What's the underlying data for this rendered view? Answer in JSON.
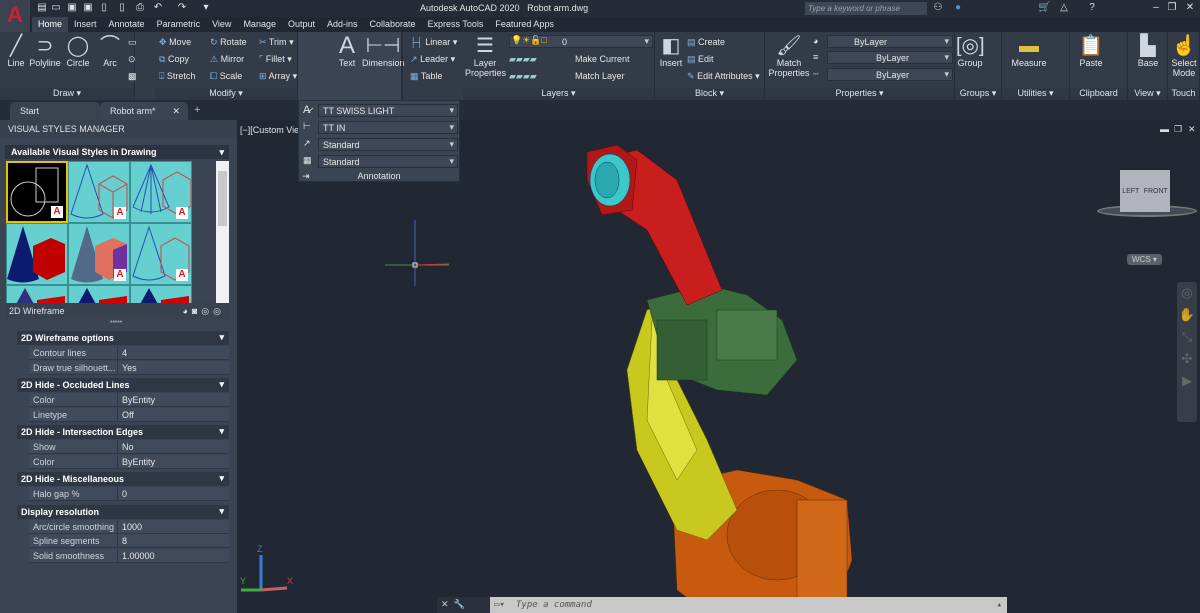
{
  "app": {
    "title": "Autodesk AutoCAD 2020",
    "file": "Robot arm.dwg",
    "logo": "A"
  },
  "search": {
    "placeholder": "Type a keyword or phrase"
  },
  "menu_tabs": [
    "Home",
    "Insert",
    "Annotate",
    "Parametric",
    "View",
    "Manage",
    "Output",
    "Add-ins",
    "Collaborate",
    "Express Tools",
    "Featured Apps"
  ],
  "active_tab": "Home",
  "ribbon": {
    "draw": {
      "title": "Draw",
      "line": "Line",
      "polyline": "Polyline",
      "circle": "Circle",
      "arc": "Arc"
    },
    "modify": {
      "title": "Modify",
      "move": "Move",
      "rotate": "Rotate",
      "trim": "Trim",
      "copy": "Copy",
      "mirror": "Mirror",
      "fillet": "Fillet",
      "stretch": "Stretch",
      "scale": "Scale",
      "array": "Array"
    },
    "annotation": {
      "text": "Text",
      "dimension": "Dimension",
      "linear": "Linear",
      "leader": "Leader",
      "table": "Table"
    },
    "layers": {
      "title": "Layers",
      "layer_properties": "Layer Properties",
      "layer_value": "0",
      "make_current": "Make Current",
      "match_layer": "Match Layer"
    },
    "block": {
      "title": "Block",
      "insert": "Insert",
      "create": "Create",
      "edit": "Edit",
      "edit_attributes": "Edit Attributes"
    },
    "properties": {
      "title": "Properties",
      "match_properties": "Match Properties",
      "color": "ByLayer",
      "linetype": "ByLayer",
      "lineweight": "ByLayer"
    },
    "groups": {
      "title": "Groups",
      "group": "Group"
    },
    "utilities": {
      "title": "Utilities",
      "measure": "Measure"
    },
    "clipboard": {
      "title": "Clipboard",
      "paste": "Paste"
    },
    "view": {
      "title": "View",
      "base": "Base"
    },
    "touch": {
      "title": "Touch",
      "select_mode": "Select Mode"
    }
  },
  "annotation_panel": {
    "title": "Annotation",
    "text_style": "TT SWISS LIGHT",
    "dim_style": "TT IN",
    "multileader_style": "Standard",
    "table_style": "Standard"
  },
  "doc_tabs": [
    {
      "label": "Start"
    },
    {
      "label": "Robot arm*"
    }
  ],
  "visual_styles_manager": {
    "title": "VISUAL STYLES MANAGER",
    "section": "Available Visual Styles in Drawing",
    "current_style": "2D Wireframe",
    "groups": [
      {
        "title": "2D Wireframe options",
        "rows": [
          {
            "k": "Contour lines",
            "v": "4"
          },
          {
            "k": "Draw true silhouett...",
            "v": "Yes"
          }
        ]
      },
      {
        "title": "2D Hide - Occluded Lines",
        "rows": [
          {
            "k": "Color",
            "v": "ByEntity"
          },
          {
            "k": "Linetype",
            "v": "Off"
          }
        ]
      },
      {
        "title": "2D Hide - Intersection Edges",
        "rows": [
          {
            "k": "Show",
            "v": "No"
          },
          {
            "k": "Color",
            "v": "ByEntity"
          }
        ]
      },
      {
        "title": "2D Hide - Miscellaneous",
        "rows": [
          {
            "k": "Halo gap %",
            "v": "0"
          }
        ]
      },
      {
        "title": "Display resolution",
        "rows": [
          {
            "k": "Arc/circle smoothing",
            "v": "1000"
          },
          {
            "k": "Spline segments",
            "v": "8"
          },
          {
            "k": "Solid smoothness",
            "v": "1.00000"
          }
        ]
      }
    ]
  },
  "viewport": {
    "label": "[−][Custom View",
    "viewcube_left": "LEFT",
    "viewcube_front": "FRONT",
    "wcs": "WCS",
    "ucs_x": "X",
    "ucs_y": "Y",
    "ucs_z": "Z"
  },
  "command": {
    "placeholder": "Type a command"
  },
  "colors": {
    "accent": "#d0202a",
    "red": "#c81e1e",
    "green": "#3c6b3c",
    "yellow": "#c8c81e",
    "orange": "#d2691e",
    "cyan": "#3cc8c8"
  }
}
